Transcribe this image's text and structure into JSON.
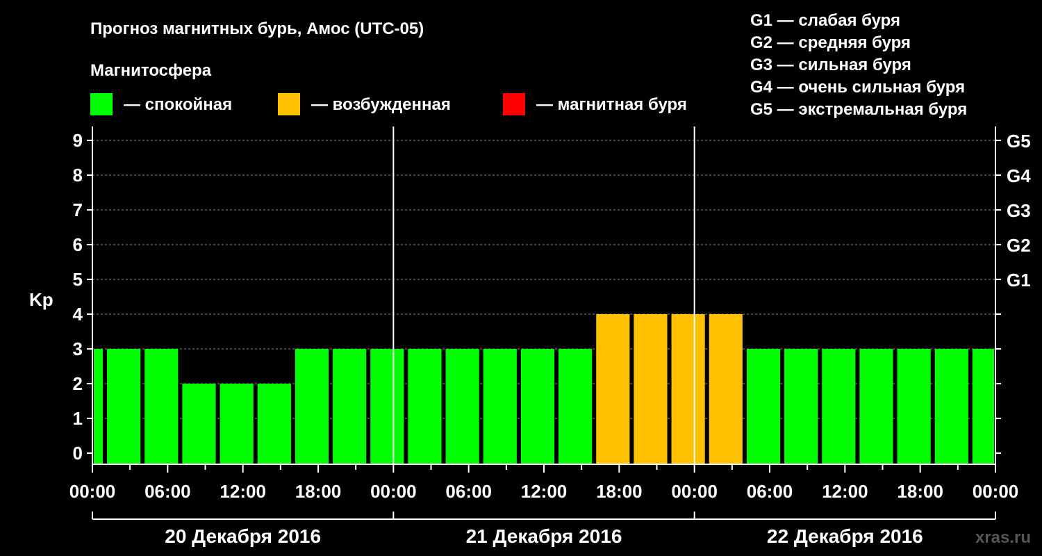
{
  "title": "Прогноз магнитных бурь, Амос (UTC-05)",
  "legend": {
    "heading": "Магнитосфера",
    "items": [
      {
        "label": "— спокойная",
        "color": "#00ff00"
      },
      {
        "label": "— возбужденная",
        "color": "#ffc000"
      },
      {
        "label": "— магнитная буря",
        "color": "#ff0000"
      }
    ]
  },
  "storm_scale": [
    "G1 — слабая буря",
    "G2 — средняя буря",
    "G3 — сильная буря",
    "G4 — очень сильная буря",
    "G5 — экстремальная буря"
  ],
  "watermark": "xras.ru",
  "chart_data": {
    "type": "bar",
    "ylabel": "Kp",
    "ylim": [
      0,
      9
    ],
    "yticks": [
      "0",
      "1",
      "2",
      "3",
      "4",
      "5",
      "6",
      "7",
      "8",
      "9"
    ],
    "right_ticks": [
      {
        "kp": 5,
        "label": "G1"
      },
      {
        "kp": 6,
        "label": "G2"
      },
      {
        "kp": 7,
        "label": "G3"
      },
      {
        "kp": 8,
        "label": "G4"
      },
      {
        "kp": 9,
        "label": "G5"
      }
    ],
    "x_tick_labels": [
      "00:00",
      "06:00",
      "12:00",
      "18:00",
      "00:00",
      "06:00",
      "12:00",
      "18:00",
      "00:00",
      "06:00",
      "12:00",
      "18:00",
      "00:00"
    ],
    "dates": [
      "20 Декабря 2016",
      "21 Декабря 2016",
      "22 Декабря 2016"
    ],
    "time_range_hours": [
      0,
      72
    ],
    "grid": true,
    "bars": [
      {
        "start_h": 0,
        "end_h": 1,
        "kp": 3,
        "level": "quiet"
      },
      {
        "start_h": 1,
        "end_h": 4,
        "kp": 3,
        "level": "quiet"
      },
      {
        "start_h": 4,
        "end_h": 7,
        "kp": 3,
        "level": "quiet"
      },
      {
        "start_h": 7,
        "end_h": 10,
        "kp": 2,
        "level": "quiet"
      },
      {
        "start_h": 10,
        "end_h": 13,
        "kp": 2,
        "level": "quiet"
      },
      {
        "start_h": 13,
        "end_h": 16,
        "kp": 2,
        "level": "quiet"
      },
      {
        "start_h": 16,
        "end_h": 19,
        "kp": 3,
        "level": "quiet"
      },
      {
        "start_h": 19,
        "end_h": 22,
        "kp": 3,
        "level": "quiet"
      },
      {
        "start_h": 22,
        "end_h": 25,
        "kp": 3,
        "level": "quiet"
      },
      {
        "start_h": 25,
        "end_h": 28,
        "kp": 3,
        "level": "quiet"
      },
      {
        "start_h": 28,
        "end_h": 31,
        "kp": 3,
        "level": "quiet"
      },
      {
        "start_h": 31,
        "end_h": 34,
        "kp": 3,
        "level": "quiet"
      },
      {
        "start_h": 34,
        "end_h": 37,
        "kp": 3,
        "level": "quiet"
      },
      {
        "start_h": 37,
        "end_h": 40,
        "kp": 3,
        "level": "quiet"
      },
      {
        "start_h": 40,
        "end_h": 43,
        "kp": 4,
        "level": "active"
      },
      {
        "start_h": 43,
        "end_h": 46,
        "kp": 4,
        "level": "active"
      },
      {
        "start_h": 46,
        "end_h": 49,
        "kp": 4,
        "level": "active"
      },
      {
        "start_h": 49,
        "end_h": 52,
        "kp": 4,
        "level": "active"
      },
      {
        "start_h": 52,
        "end_h": 55,
        "kp": 3,
        "level": "quiet"
      },
      {
        "start_h": 55,
        "end_h": 58,
        "kp": 3,
        "level": "quiet"
      },
      {
        "start_h": 58,
        "end_h": 61,
        "kp": 3,
        "level": "quiet"
      },
      {
        "start_h": 61,
        "end_h": 64,
        "kp": 3,
        "level": "quiet"
      },
      {
        "start_h": 64,
        "end_h": 67,
        "kp": 3,
        "level": "quiet"
      },
      {
        "start_h": 67,
        "end_h": 70,
        "kp": 3,
        "level": "quiet"
      },
      {
        "start_h": 70,
        "end_h": 72,
        "kp": 3,
        "level": "quiet"
      }
    ],
    "colors": {
      "quiet": "#00ff00",
      "active": "#ffc000",
      "storm": "#ff0000"
    }
  }
}
